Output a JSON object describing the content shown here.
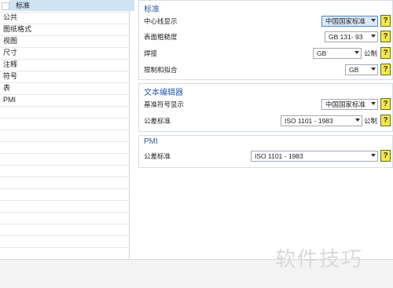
{
  "tree": {
    "items": [
      {
        "label": "标准",
        "selected": true
      },
      {
        "label": "公共"
      },
      {
        "label": "图纸格式"
      },
      {
        "label": "视图"
      },
      {
        "label": "尺寸"
      },
      {
        "label": "注释"
      },
      {
        "label": "符号"
      },
      {
        "label": "表"
      },
      {
        "label": "PMI"
      }
    ]
  },
  "sections": {
    "standard": {
      "title": "标准",
      "rows": [
        {
          "label": "中心线显示",
          "value": "中国国家标准"
        },
        {
          "label": "表面粗糙度",
          "value": "GB 131- 93"
        },
        {
          "label": "焊接",
          "value": "GB",
          "unit": "公制"
        },
        {
          "label": "限制和拟合",
          "value": "GB"
        }
      ]
    },
    "text_editor": {
      "title": "文本编辑器",
      "rows": [
        {
          "label": "基准符号显示",
          "value": "中国国家标准"
        },
        {
          "label": "公差标准",
          "value": "ISO 1101 - 1983",
          "unit": "公制"
        }
      ]
    },
    "pmi": {
      "title": "PMI",
      "rows": [
        {
          "label": "公差标准",
          "value": "ISO 1101 - 1983"
        }
      ]
    }
  },
  "help_label": "?",
  "watermark": "软件技巧",
  "colors": {
    "selection": "#cfe3f3",
    "section_title": "#2a5aa3",
    "help_bg": "#f6e84a"
  }
}
